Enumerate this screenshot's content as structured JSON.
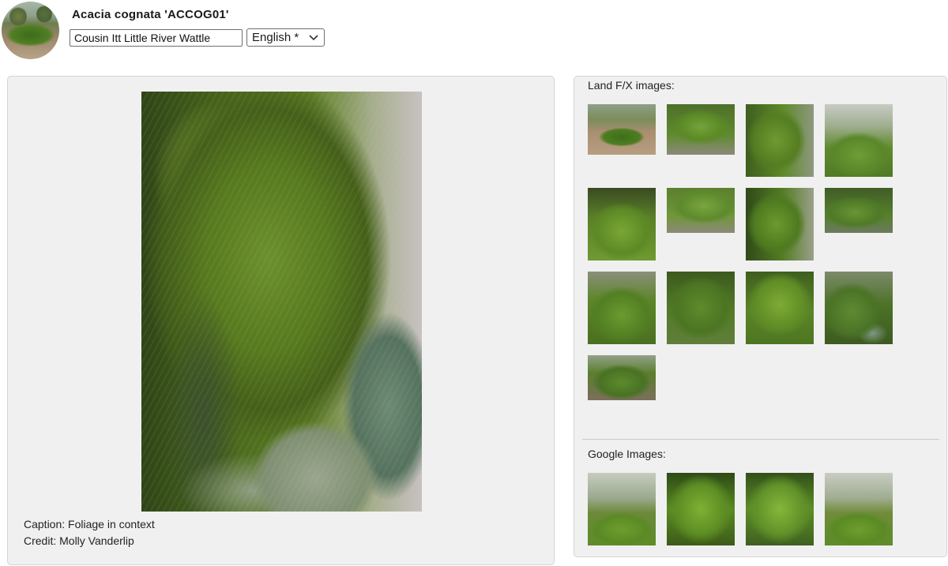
{
  "header": {
    "plant_name": "Acacia cognata 'ACCOG01'",
    "common_name_value": "Cousin Itt Little River Wattle",
    "language": "English *"
  },
  "main_image": {
    "caption": "Caption: Foliage in context",
    "credit": "Credit: Molly Vanderlip"
  },
  "landfx": {
    "label": "Land F/X images:",
    "thumbnails": [
      {
        "icon": "thumbnail-landfx-1"
      },
      {
        "icon": "thumbnail-landfx-2"
      },
      {
        "icon": "thumbnail-landfx-3"
      },
      {
        "icon": "thumbnail-landfx-4"
      },
      {
        "icon": "thumbnail-landfx-5"
      },
      {
        "icon": "thumbnail-landfx-6"
      },
      {
        "icon": "thumbnail-landfx-7"
      },
      {
        "icon": "thumbnail-landfx-8"
      },
      {
        "icon": "thumbnail-landfx-9"
      },
      {
        "icon": "thumbnail-landfx-10"
      },
      {
        "icon": "thumbnail-landfx-11"
      },
      {
        "icon": "thumbnail-landfx-12"
      },
      {
        "icon": "thumbnail-landfx-13"
      }
    ]
  },
  "google": {
    "label": "Google Images:",
    "thumbnails": [
      {
        "icon": "thumbnail-google-1"
      },
      {
        "icon": "thumbnail-google-2"
      },
      {
        "icon": "thumbnail-google-3"
      },
      {
        "icon": "thumbnail-google-4"
      }
    ]
  }
}
